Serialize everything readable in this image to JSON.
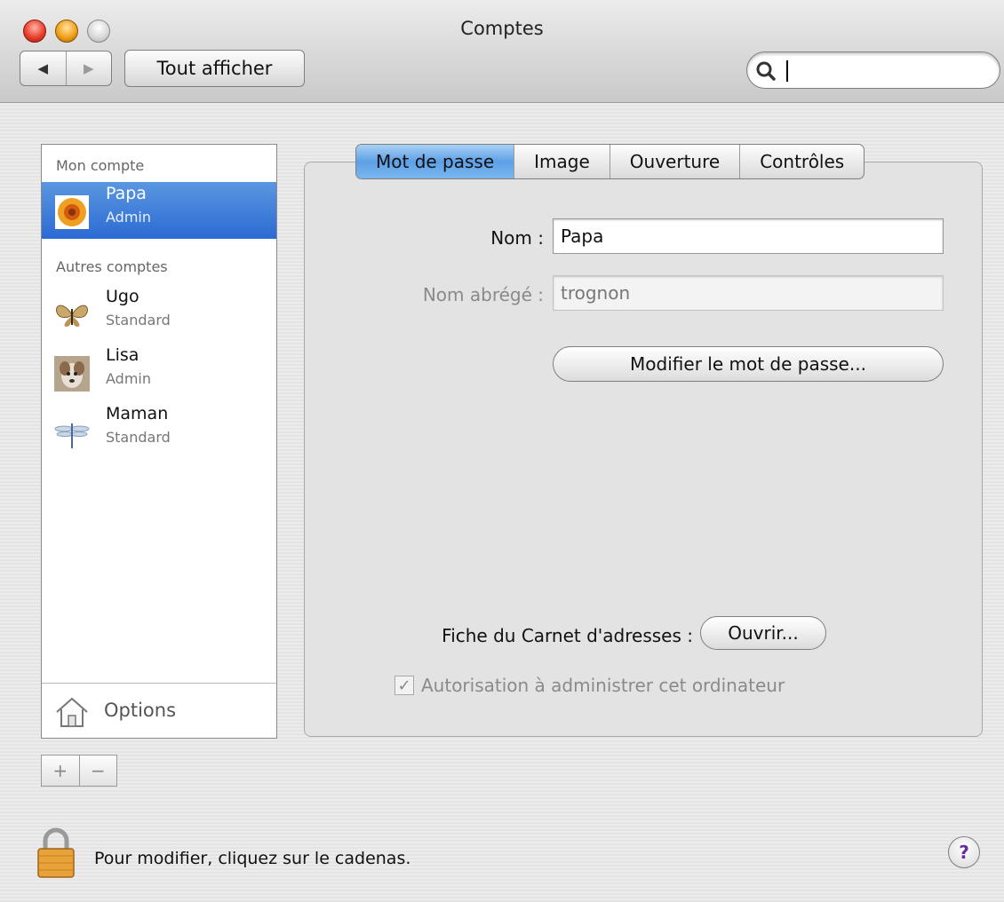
{
  "window": {
    "title": "Comptes"
  },
  "toolbar": {
    "back_label": "◀",
    "forward_label": "▶",
    "show_all_label": "Tout afficher",
    "search_value": "",
    "search_placeholder": ""
  },
  "accounts": {
    "my_account_header": "Mon compte",
    "other_accounts_header": "Autres comptes",
    "items": [
      {
        "name": "Papa",
        "role": "Admin",
        "picture_icon": "sunflower-icon",
        "selected": true
      },
      {
        "name": "Ugo",
        "role": "Standard",
        "picture_icon": "butterfly-icon",
        "selected": false
      },
      {
        "name": "Lisa",
        "role": "Admin",
        "picture_icon": "dog-photo-icon",
        "selected": false
      },
      {
        "name": "Maman",
        "role": "Standard",
        "picture_icon": "dragonfly-icon",
        "selected": false
      }
    ],
    "options_label": "Options",
    "add_label": "+",
    "remove_label": "−"
  },
  "tabs": [
    {
      "label": "Mot de passe",
      "active": true
    },
    {
      "label": "Image",
      "active": false
    },
    {
      "label": "Ouverture",
      "active": false
    },
    {
      "label": "Contrôles",
      "active": false
    }
  ],
  "form": {
    "name_label": "Nom :",
    "name_value": "Papa",
    "short_name_label": "Nom abrégé :",
    "short_name_value": "trognon",
    "change_password_label": "Modifier le mot de passe...",
    "address_book_label": "Fiche du Carnet d'adresses :",
    "open_label": "Ouvrir...",
    "admin_checkbox_label": "Autorisation à administrer cet ordinateur",
    "admin_checked": true
  },
  "footer": {
    "lock_text": "Pour modifier, cliquez sur le cadenas.",
    "help_label": "?"
  },
  "colors": {
    "selection": "#2c6ad4",
    "active_tab": "#5ea0e6",
    "close": "#e8412c",
    "minimize": "#f0a21a"
  }
}
